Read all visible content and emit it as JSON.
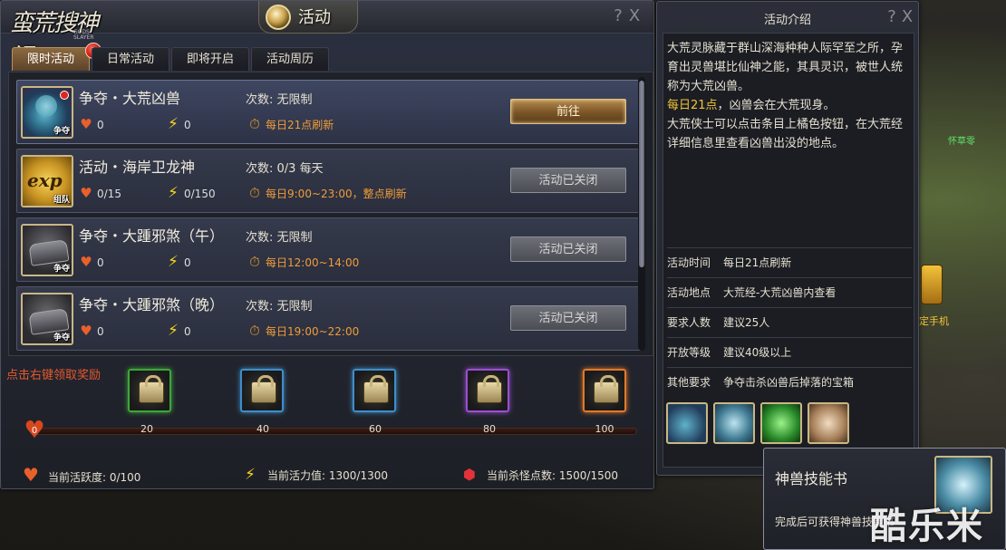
{
  "logo": {
    "text": "蛮荒搜神记",
    "sub": "GODS SLAYER"
  },
  "window": {
    "title": "活动",
    "help": "?",
    "close": "X"
  },
  "tabs": [
    {
      "label": "限时活动",
      "alert": "!"
    },
    {
      "label": "日常活动"
    },
    {
      "label": "即将开启"
    },
    {
      "label": "活动周历"
    }
  ],
  "activities": [
    {
      "name": "争夺・大荒凶兽",
      "count": "次数: 无限制",
      "vitality": "0",
      "energy": "0",
      "time": "每日21点刷新",
      "button": "前往",
      "badge": "争夺"
    },
    {
      "name": "活动・海岸卫龙神",
      "count": "次数: 0/3 每天",
      "vitality": "0/15",
      "energy": "0/150",
      "time": "每日9:00~23:00，整点刷新",
      "button": "活动已关闭",
      "badge": "组队",
      "icon_text": "exp"
    },
    {
      "name": "争夺・大踵邪煞（午）",
      "count": "次数: 无限制",
      "vitality": "0",
      "energy": "0",
      "time": "每日12:00~14:00",
      "button": "活动已关闭",
      "badge": "争夺"
    },
    {
      "name": "争夺・大踵邪煞（晚）",
      "count": "次数: 无限制",
      "vitality": "0",
      "energy": "0",
      "time": "每日19:00~22:00",
      "button": "活动已关闭",
      "badge": "争夺"
    }
  ],
  "rewards": {
    "hint": "点击右键领取奖励",
    "current_level": "0",
    "levels": [
      "20",
      "40",
      "60",
      "80",
      "100"
    ],
    "chest_colors": [
      "#3fa53a",
      "#3f8ec9",
      "#3f8ec9",
      "#9a4fd1",
      "#e07a2a"
    ]
  },
  "bottom": {
    "vitality": "当前活跃度: 0/100",
    "energy": "当前活力值: 1300/1300",
    "kills": "当前杀怪点数: 1500/1500"
  },
  "intro": {
    "title": "活动介绍",
    "help": "?",
    "close": "X",
    "desc_a": "大荒灵脉藏于群山深海种种人际罕至之所，孕育出灵兽堪比仙神之能，其具灵识，被世人统称为大荒凶兽。",
    "desc_highlight": "每日21点",
    "desc_b": "，凶兽会在大荒现身。",
    "desc_c": "大荒侠士可以点击条目上橘色按钮，在大荒经详细信息里查看凶兽出没的地点。",
    "info": [
      {
        "k": "活动时间",
        "v": "每日21点刷新"
      },
      {
        "k": "活动地点",
        "v": "大荒经-大荒凶兽内查看"
      },
      {
        "k": "要求人数",
        "v": "建议25人"
      },
      {
        "k": "开放等级",
        "v": "建议40级以上"
      },
      {
        "k": "其他要求",
        "v": "争夺击杀凶兽后掉落的宝箱"
      }
    ]
  },
  "tooltip": {
    "name": "神兽技能书",
    "desc": "完成后可获得神兽技能书"
  },
  "side": {
    "phone_label": "定手机",
    "green_text": "怀草零"
  },
  "watermark": "酷乐米"
}
